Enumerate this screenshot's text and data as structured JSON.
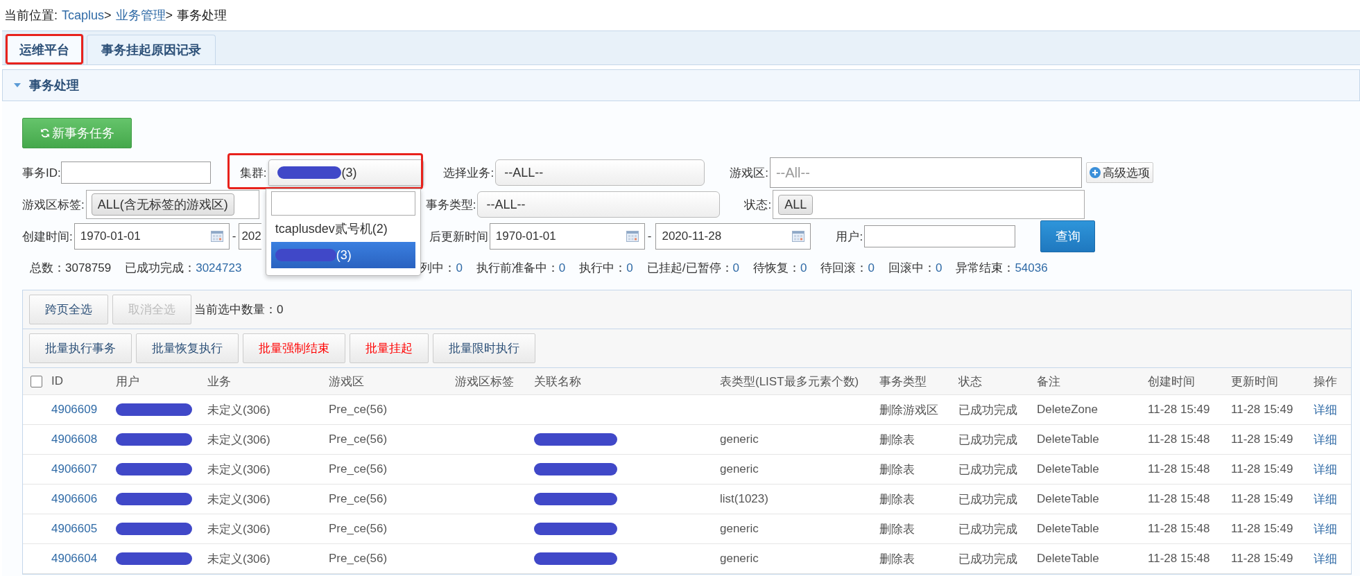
{
  "breadcrumb": {
    "prefix": "当前位置:",
    "items": [
      {
        "text": "Tcaplus",
        "kind": "link"
      },
      {
        "text": ">",
        "kind": "sep"
      },
      {
        "text": "业务管理",
        "kind": "link"
      },
      {
        "text": ">",
        "kind": "sep"
      },
      {
        "text": "事务处理",
        "kind": "plain"
      }
    ]
  },
  "tabs": [
    {
      "label": "运维平台",
      "selected": true,
      "highlighted": true
    },
    {
      "label": "事务挂起原因记录",
      "selected": false,
      "highlighted": false
    }
  ],
  "section": {
    "title": "事务处理",
    "expanded": true
  },
  "new_task_button": "新事务任务",
  "filters": {
    "task_id": {
      "label": "事务ID:"
    },
    "cluster": {
      "label": "集群:",
      "value": "(3)",
      "redacted": true,
      "highlighted": true,
      "options": [
        {
          "label": "tcaplusdev贰号机(2)",
          "selected": false,
          "redacted": false
        },
        {
          "label": "(3)",
          "selected": true,
          "redacted": true
        }
      ]
    },
    "business": {
      "label": "选择业务:",
      "value": "--ALL--"
    },
    "zone": {
      "label": "游戏区:",
      "placeholder": "--All--"
    },
    "advanced_button": "高级选项",
    "zone_tag": {
      "label": "游戏区标签:",
      "chips": [
        "ALL(含无标签的游戏区)"
      ]
    },
    "task_type": {
      "label": "事务类型:",
      "value": "--ALL--"
    },
    "status": {
      "label": "状态:",
      "chips": [
        "ALL"
      ]
    },
    "created": {
      "label": "创建时间:",
      "from": "1970-01-01",
      "separator": "-",
      "to": "202"
    },
    "updated": {
      "label": "后更新时间",
      "from": "1970-01-01",
      "separator": "-",
      "to": "2020-11-28"
    },
    "user": {
      "label": "用户:"
    },
    "query_button": "查询"
  },
  "stats": [
    {
      "label": "总数：",
      "value": "3078759",
      "kind": "plain"
    },
    {
      "label": "已成功完成：",
      "value": "3024723",
      "kind": "link"
    },
    {
      "label": "列中：",
      "value": "0",
      "kind": "link"
    },
    {
      "label": "执行前准备中：",
      "value": "0",
      "kind": "link"
    },
    {
      "label": "执行中：",
      "value": "0",
      "kind": "link"
    },
    {
      "label": "已挂起/已暂停：",
      "value": "0",
      "kind": "link"
    },
    {
      "label": "待恢复：",
      "value": "0",
      "kind": "link"
    },
    {
      "label": "待回滚：",
      "value": "0",
      "kind": "link"
    },
    {
      "label": "回滚中：",
      "value": "0",
      "kind": "link"
    },
    {
      "label": "异常结束：",
      "value": "54036",
      "kind": "link"
    }
  ],
  "table": {
    "select_all_pages": {
      "label": "跨页全选",
      "disabled": false
    },
    "cancel_select": {
      "label": "取消全选",
      "disabled": true
    },
    "selected_count": "当前选中数量：0",
    "batch_buttons": [
      {
        "label": "批量执行事务",
        "danger": false
      },
      {
        "label": "批量恢复执行",
        "danger": false
      },
      {
        "label": "批量强制结束",
        "danger": true
      },
      {
        "label": "批量挂起",
        "danger": true
      },
      {
        "label": "批量限时执行",
        "danger": false
      }
    ],
    "header_checkbox": {
      "checked": false
    },
    "columns": [
      "ID",
      "用户",
      "业务",
      "游戏区",
      "游戏区标签",
      "关联名称",
      "表类型(LIST最多元素个数)",
      "事务类型",
      "状态",
      "备注",
      "创建时间",
      "更新时间",
      "操作"
    ],
    "rows": [
      {
        "id": "4906609",
        "user_redacted": true,
        "business": "未定义(306)",
        "zone": "Pre_ce(56)",
        "related_redacted": false,
        "task_type": "删除游戏区",
        "status": "已成功完成",
        "note": "DeleteZone",
        "created": "11-28 15:49",
        "updated": "11-28 15:49",
        "action": "详细"
      },
      {
        "id": "4906608",
        "user_redacted": true,
        "business": "未定义(306)",
        "zone": "Pre_ce(56)",
        "related_redacted": true,
        "table_type": "generic",
        "task_type": "删除表",
        "status": "已成功完成",
        "note": "DeleteTable",
        "created": "11-28 15:48",
        "updated": "11-28 15:49",
        "action": "详细"
      },
      {
        "id": "4906607",
        "user_redacted": true,
        "business": "未定义(306)",
        "zone": "Pre_ce(56)",
        "related_redacted": true,
        "table_type": "generic",
        "task_type": "删除表",
        "status": "已成功完成",
        "note": "DeleteTable",
        "created": "11-28 15:48",
        "updated": "11-28 15:49",
        "action": "详细"
      },
      {
        "id": "4906606",
        "user_redacted": true,
        "business": "未定义(306)",
        "zone": "Pre_ce(56)",
        "related_redacted": true,
        "table_type": "list(1023)",
        "task_type": "删除表",
        "status": "已成功完成",
        "note": "DeleteTable",
        "created": "11-28 15:48",
        "updated": "11-28 15:49",
        "action": "详细"
      },
      {
        "id": "4906605",
        "user_redacted": true,
        "business": "未定义(306)",
        "zone": "Pre_ce(56)",
        "related_redacted": true,
        "table_type": "generic",
        "task_type": "删除表",
        "status": "已成功完成",
        "note": "DeleteTable",
        "created": "11-28 15:48",
        "updated": "11-28 15:49",
        "action": "详细"
      },
      {
        "id": "4906604",
        "user_redacted": true,
        "business": "未定义(306)",
        "zone": "Pre_ce(56)",
        "related_redacted": true,
        "table_type": "generic",
        "task_type": "删除表",
        "status": "已成功完成",
        "note": "DeleteTable",
        "created": "11-28 15:48",
        "updated": "11-28 15:49",
        "action": "详细"
      }
    ]
  }
}
